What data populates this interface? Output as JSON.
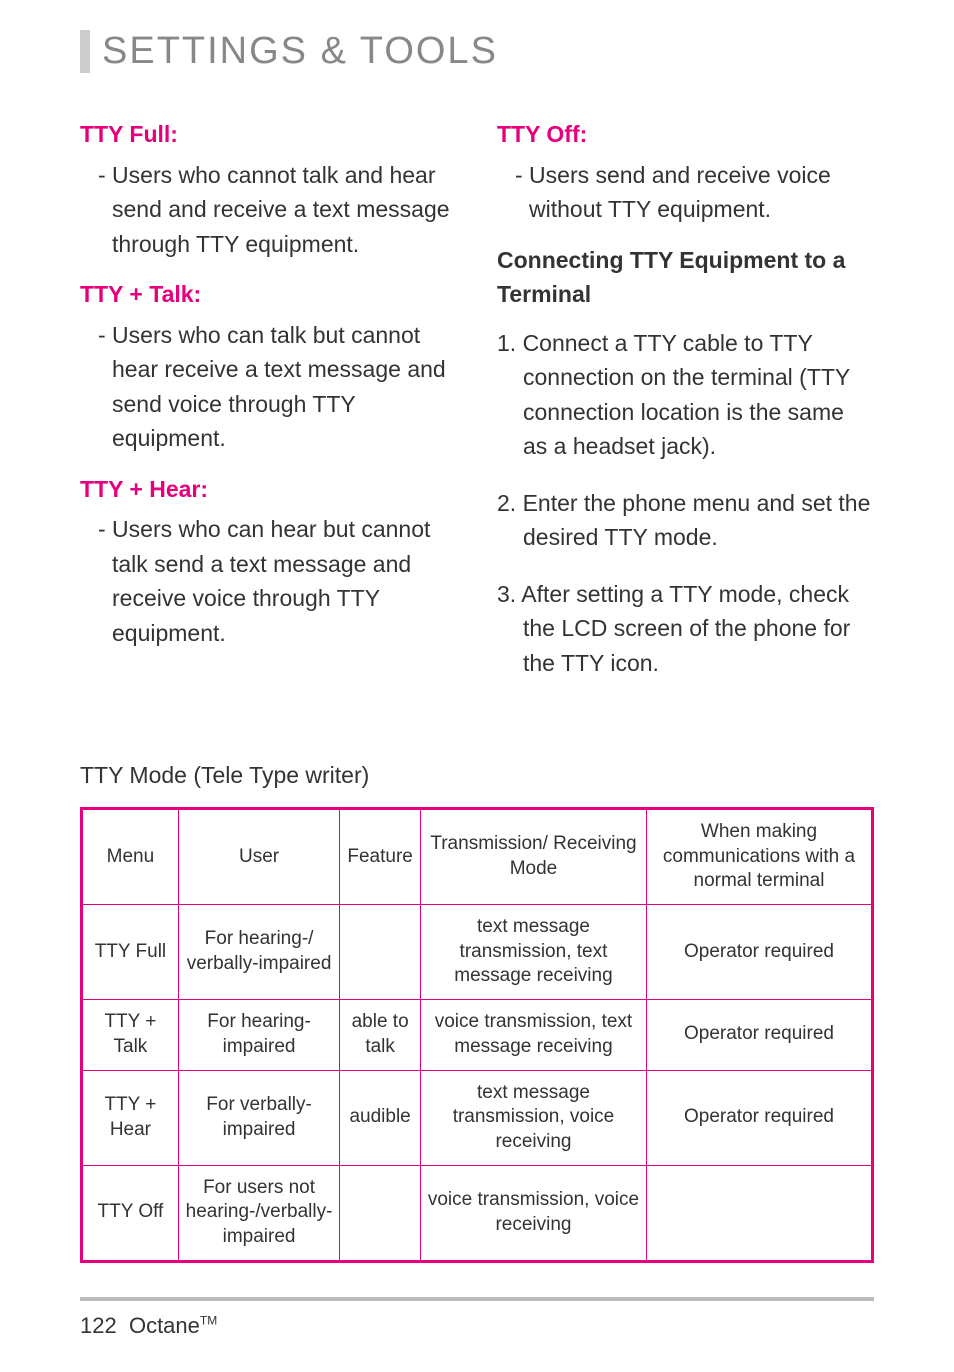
{
  "title": "SETTINGS & TOOLS",
  "left": {
    "modes": [
      {
        "name": "TTY Full:",
        "desc": "- Users who cannot  talk and hear send and receive a text message through TTY equipment."
      },
      {
        "name": "TTY + Talk:",
        "desc": "- Users who can talk but cannot hear receive a text message and send voice through TTY equipment."
      },
      {
        "name": "TTY + Hear:",
        "desc": "- Users who can hear but cannot talk send a text message and receive voice through TTY equipment."
      }
    ]
  },
  "right": {
    "mode": {
      "name": "TTY Off:",
      "desc": "- Users send and receive voice without TTY equipment."
    },
    "heading": "Connecting TTY Equipment to a Terminal",
    "steps": [
      "1. Connect a TTY cable to TTY connection on the terminal (TTY connection location is the same as a headset jack).",
      "2. Enter the phone menu and set the desired TTY mode.",
      "3. After setting a TTY mode, check the LCD screen of the phone for the TTY icon."
    ]
  },
  "table_title": "TTY Mode (Tele Type writer)",
  "table": {
    "headers": [
      "Menu",
      "User",
      "Feature",
      "Transmission/ Receiving Mode",
      "When making communications with a normal terminal"
    ],
    "rows": [
      {
        "menu": "TTY Full",
        "user": "For hearing-/ verbally-impaired",
        "feature": "",
        "mode": "text message transmission, text message receiving",
        "comm": "Operator required"
      },
      {
        "menu": "TTY + Talk",
        "user": "For hearing-impaired",
        "feature": "able to talk",
        "mode": "voice transmission, text message receiving",
        "comm": "Operator required"
      },
      {
        "menu": "TTY + Hear",
        "user": "For verbally-impaired",
        "feature": "audible",
        "mode": "text message transmission, voice receiving",
        "comm": "Operator required"
      },
      {
        "menu": "TTY Off",
        "user": "For users not hearing-/verbally-impaired",
        "feature": "",
        "mode": "voice transmission, voice receiving",
        "comm": ""
      }
    ]
  },
  "footer": {
    "page": "122",
    "product": "Octane",
    "tm": "TM"
  }
}
